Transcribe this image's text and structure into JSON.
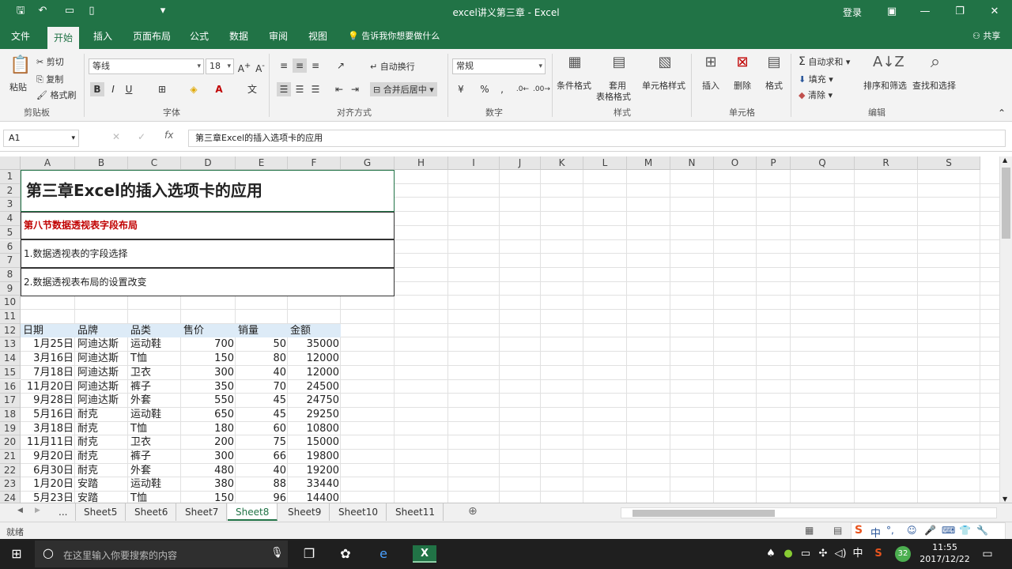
{
  "titlebar": {
    "title": "excel讲义第三章  -  Excel",
    "login": "登录"
  },
  "tabs": [
    "文件",
    "开始",
    "插入",
    "页面布局",
    "公式",
    "数据",
    "审阅",
    "视图"
  ],
  "tell_me": "告诉我你想要做什么",
  "share": "共享",
  "ribbon": {
    "paste": "粘贴",
    "cut": "剪切",
    "copy": "复制",
    "format_painter": "格式刷",
    "clipboard": "剪贴板",
    "font_name": "等线",
    "font_size": "18",
    "font_group": "字体",
    "wrap": "自动换行",
    "merge": "合并后居中",
    "align_group": "对齐方式",
    "number_format": "常规",
    "number_group": "数字",
    "cond_format": "条件格式",
    "table_format_1": "套用",
    "table_format_2": "表格格式",
    "cell_style": "单元格样式",
    "styles_group": "样式",
    "insert": "插入",
    "delete": "删除",
    "format": "格式",
    "cells_group": "单元格",
    "autosum": "自动求和",
    "fill": "填充",
    "clear": "清除",
    "sort_filter": "排序和筛选",
    "find_select": "查找和选择",
    "edit_group": "编辑"
  },
  "formula_bar": {
    "name_box": "A1",
    "fx": "fx",
    "content": "第三章Excel的插入选项卡的应用"
  },
  "columns": [
    "A",
    "B",
    "C",
    "D",
    "E",
    "F",
    "G",
    "H",
    "I",
    "J",
    "K",
    "L",
    "M",
    "N",
    "O",
    "P",
    "Q",
    "R",
    "S"
  ],
  "rows": [
    "1",
    "2",
    "3",
    "4",
    "5",
    "6",
    "7",
    "8",
    "9",
    "10",
    "11",
    "12",
    "13",
    "14",
    "15",
    "16",
    "17",
    "18",
    "19",
    "20",
    "21",
    "22",
    "23",
    "24"
  ],
  "cells": {
    "title": "第三章Excel的插入选项卡的应用",
    "section": "第八节数据透视表字段布局",
    "item1": "1.数据透视表的字段选择",
    "item2": "2.数据透视表布局的设置改变"
  },
  "table": {
    "headers": [
      "日期",
      "品牌",
      "品类",
      "售价",
      "销量",
      "金额"
    ],
    "rows": [
      [
        "1月25日",
        "阿迪达斯",
        "运动鞋",
        "700",
        "50",
        "35000"
      ],
      [
        "3月16日",
        "阿迪达斯",
        "T恤",
        "150",
        "80",
        "12000"
      ],
      [
        "7月18日",
        "阿迪达斯",
        "卫衣",
        "300",
        "40",
        "12000"
      ],
      [
        "11月20日",
        "阿迪达斯",
        "裤子",
        "350",
        "70",
        "24500"
      ],
      [
        "9月28日",
        "阿迪达斯",
        "外套",
        "550",
        "45",
        "24750"
      ],
      [
        "5月16日",
        "耐克",
        "运动鞋",
        "650",
        "45",
        "29250"
      ],
      [
        "3月18日",
        "耐克",
        "T恤",
        "180",
        "60",
        "10800"
      ],
      [
        "11月11日",
        "耐克",
        "卫衣",
        "200",
        "75",
        "15000"
      ],
      [
        "9月20日",
        "耐克",
        "裤子",
        "300",
        "66",
        "19800"
      ],
      [
        "6月30日",
        "耐克",
        "外套",
        "480",
        "40",
        "19200"
      ],
      [
        "1月20日",
        "安踏",
        "运动鞋",
        "380",
        "88",
        "33440"
      ],
      [
        "5月23日",
        "安踏",
        "T恤",
        "150",
        "96",
        "14400"
      ]
    ]
  },
  "sheets": [
    "...",
    "Sheet5",
    "Sheet6",
    "Sheet7",
    "Sheet8",
    "Sheet9",
    "Sheet10",
    "Sheet11"
  ],
  "active_sheet": "Sheet8",
  "status": {
    "ready": "就绪"
  },
  "taskbar": {
    "search_placeholder": "在这里输入你要搜索的内容",
    "time": "11:55",
    "date": "2017/12/22",
    "ime": "中",
    "badge": "32"
  },
  "colors": {
    "excel_green": "#217346",
    "section_red": "#c00000",
    "header_blue": "#ddebf7"
  }
}
